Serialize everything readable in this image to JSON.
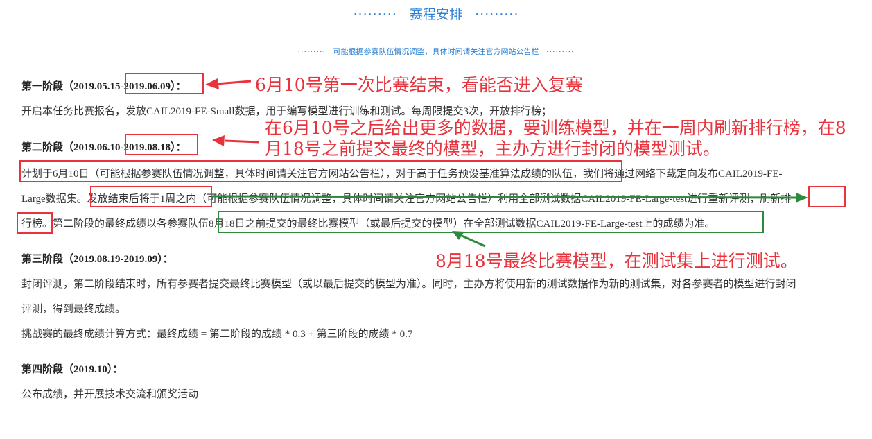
{
  "header": {
    "title": "赛程安排",
    "subtitle": "可能根据参赛队伍情况调整，具体时间请关注官方网站公告栏",
    "dots": "·········"
  },
  "stages": [
    {
      "heading": "第一阶段（2019.05.15-2019.06.09）：",
      "lines": [
        "开启本任务比赛报名，发放CAIL2019-FE-Small数据，用于编写模型进行训练和测试。每周限提交3次，开放排行榜；"
      ]
    },
    {
      "heading": "第二阶段（2019.06.10-2019.08.18）：",
      "lines": [
        "计划于6月10日（可能根据参赛队伍情况调整，具体时间请关注官方网站公告栏），对于高于任务预设基准算法成绩的队伍，我们将通过网络下载定向发布CAIL2019-FE-",
        "Large数据集。发放结束后将于1周之内（可能根据参赛队伍情况调整，具体时间请关注官方网站公告栏）利用全部测试数据CAIL2019-FE-Large-test进行重新评测，刷新排",
        "行榜。第二阶段的最终成绩以各参赛队伍8月18日之前提交的最终比赛模型（或最后提交的模型）在全部测试数据CAIL2019-FE-Large-test上的成绩为准。"
      ]
    },
    {
      "heading": "第三阶段（2019.08.19-2019.09）：",
      "lines": [
        "封闭评测，第二阶段结束时，所有参赛者提交最终比赛模型（或以最后提交的模型为准）。同时，主办方将使用新的测试数据作为新的测试集，对各参赛者的模型进行封闭",
        "评测，得到最终成绩。",
        "挑战赛的最终成绩计算方式：最终成绩 = 第二阶段的成绩 * 0.3 + 第三阶段的成绩 * 0.7"
      ]
    },
    {
      "heading": "第四阶段（2019.10）：",
      "lines": [
        "公布成绩，并开展技术交流和颁奖活动"
      ]
    }
  ],
  "annotations": {
    "note1": "6月10号第一次比赛结束，看能否进入复赛",
    "note2": "在6月10号之后给出更多的数据，要训练模型，并在一周内刷新排行榜，在8月18号之前提交最终的模型，主办方进行封闭的模型测试。",
    "note3": "8月18号最终比赛模型，在测试集上进行测试。",
    "red_color": "#e8323c",
    "green_color": "#2d8a3a"
  }
}
